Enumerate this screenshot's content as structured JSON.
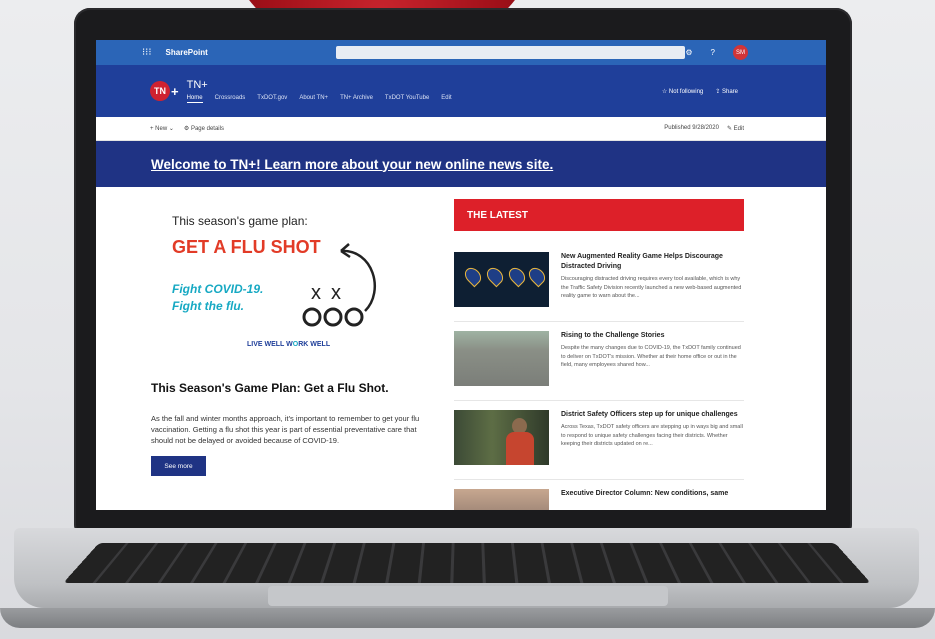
{
  "suitebar": {
    "app_name": "SharePoint",
    "waffle_icon": "waffle-icon",
    "avatar_initials": "SM"
  },
  "site": {
    "logo_text": "TN",
    "logo_plus": "+",
    "title": "TN+",
    "nav": [
      "Home",
      "Crossroads",
      "TxDOT.gov",
      "About TN+",
      "TN+ Archive",
      "TxDOT YouTube",
      "Edit"
    ],
    "follow_label": "Not following",
    "share_label": "Share"
  },
  "cmdbar": {
    "new_label": "New",
    "page_details_label": "Page details",
    "published_label": "Published 9/28/2020",
    "edit_label": "Edit"
  },
  "banner": {
    "text": "Welcome to TN+! Learn more about your new online news site."
  },
  "feature": {
    "season_line": "This season's game plan:",
    "headline": "GET A FLU SHOT",
    "fight_line1": "Fight COVID-19.",
    "fight_line2": "Fight the flu.",
    "brand_part1": "LIVE WELL W",
    "brand_part2": "O",
    "brand_part3": "RK WELL",
    "article_title": "This Season's Game Plan: Get a Flu Shot.",
    "article_body": "As the fall and winter months approach, it's important to remember to get your flu vaccination. Getting a flu shot this year is part of essential preventative care that should not be delayed or avoided because of COVID-19.",
    "see_more_label": "See more"
  },
  "latest": {
    "header": "THE LATEST",
    "items": [
      {
        "title": "New Augmented Reality Game Helps Discourage Distracted Driving",
        "snippet": "Discouraging distracted driving requires every tool available, which is why the Traffic Safety Division recently launched a new web-based augmented reality game to warn about the..."
      },
      {
        "title": "Rising to the Challenge Stories",
        "snippet": "Despite the many changes due to COVID-19, the TxDOT family continued to deliver on TxDOT's mission. Whether at their home office or out in the field, many employees shared how..."
      },
      {
        "title": "District Safety Officers step up for unique challenges",
        "snippet": "Across Texas, TxDOT safety officers are stepping up in ways big and small to respond to unique safety challenges facing their districts. Whether keeping their districts updated on re..."
      },
      {
        "title": "Executive Director Column: New conditions, same",
        "snippet": ""
      }
    ]
  },
  "colors": {
    "suitebar": "#2b65b7",
    "site_header": "#1f3f9a",
    "banner": "#1f3384",
    "latest_header": "#dd2029",
    "flu_headline": "#e23b27",
    "fight_text": "#17a9c3"
  }
}
